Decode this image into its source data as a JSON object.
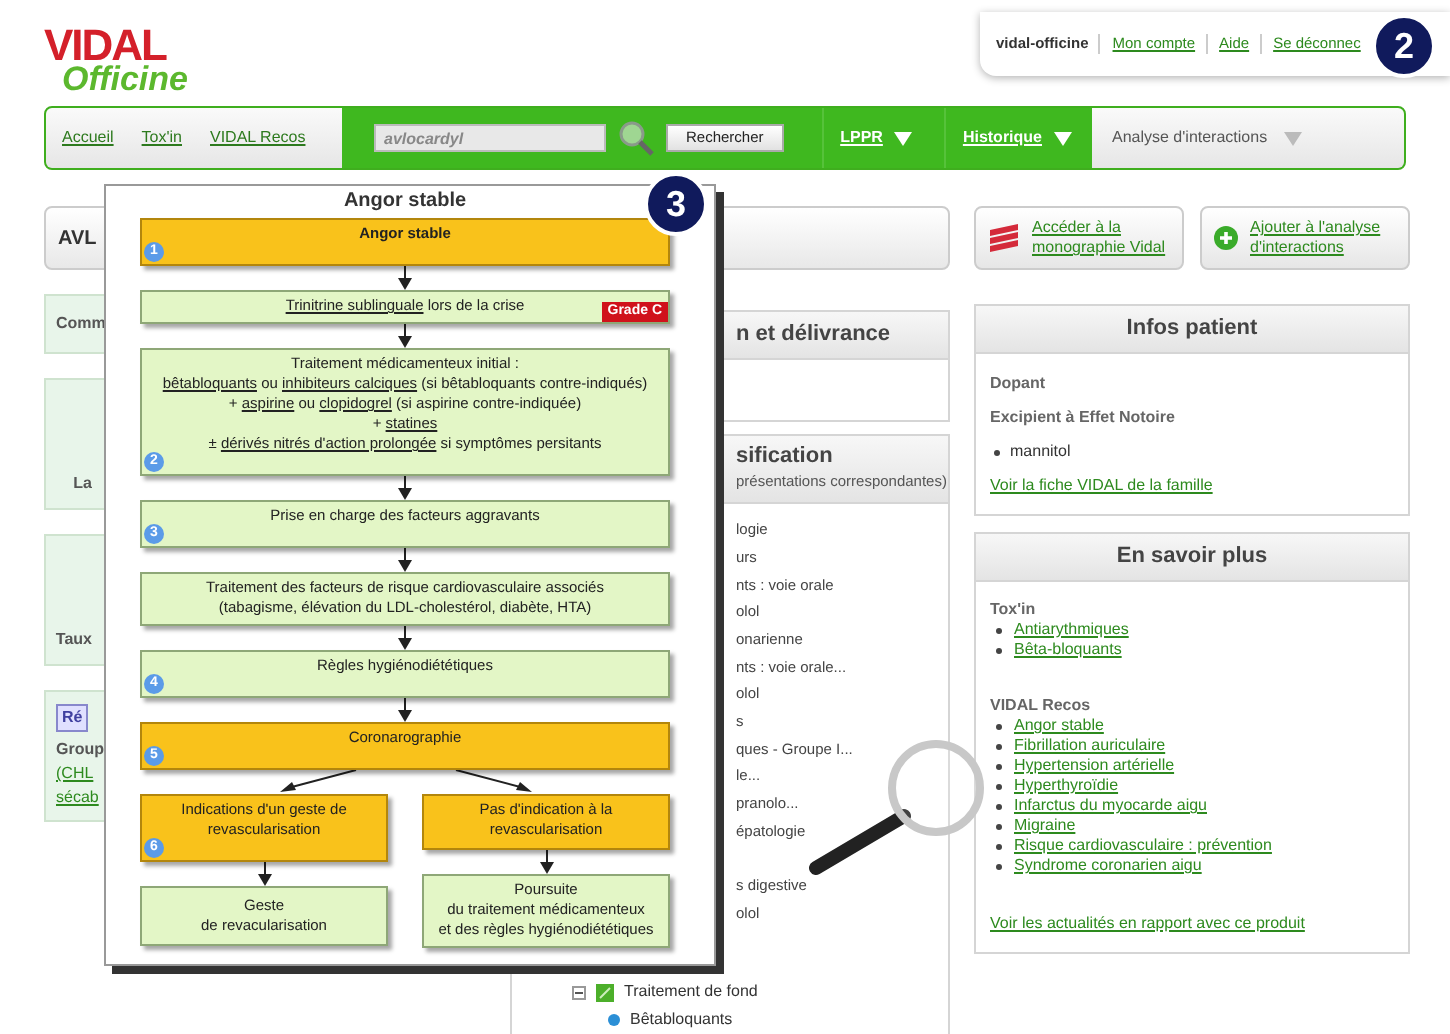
{
  "logo": {
    "line_1": "VIDAL",
    "line_2": "Officine"
  },
  "account_bar": {
    "user": "vidal-officine",
    "links": [
      "Mon compte",
      "Aide",
      "Se déconnec"
    ]
  },
  "callouts": [
    "2",
    "3"
  ],
  "nav": {
    "links": [
      "Accueil",
      "Tox'in",
      "VIDAL Recos"
    ],
    "search": {
      "value": "avlocardyl"
    },
    "search_button": "Rechercher",
    "menus": [
      {
        "label": "LPPR",
        "kind": "green"
      },
      {
        "label": "Historique",
        "kind": "green"
      },
      {
        "label": "Analyse d'interactions",
        "kind": "plain"
      }
    ]
  },
  "left_column": {
    "title": "AVL",
    "boxes": [
      {
        "lines": [
          "Comm"
        ],
        "kind": "center"
      },
      {
        "lines": [
          "La"
        ],
        "kind": "bottom"
      },
      {
        "lines": [
          "Taux"
        ],
        "kind": "bottom"
      },
      {
        "kind": "reimbursement",
        "badge": "Ré",
        "lines": [
          "Group"
        ],
        "links": [
          "(CHL",
          "sécab"
        ]
      }
    ]
  },
  "flowchart": {
    "title": "Angor stable",
    "steps": [
      {
        "kind": "start",
        "badge": "1",
        "lines": [
          [
            {
              "text": "Angor stable",
              "link": false
            }
          ]
        ]
      },
      {
        "kind": "action",
        "grade": "Grade C",
        "lines": [
          [
            {
              "text": "Trinitrine sublinguale",
              "link": true
            },
            {
              "text": " lors de la crise",
              "link": false
            }
          ]
        ]
      },
      {
        "kind": "action",
        "badge": "2",
        "lines": [
          [
            {
              "text": "Traitement médicamenteux initial :",
              "link": false
            }
          ],
          [
            {
              "text": "bêtabloquants",
              "link": true
            },
            {
              "text": " ou ",
              "link": false
            },
            {
              "text": "inhibiteurs calciques",
              "link": true
            },
            {
              "text": " (si bêtabloquants contre-indiqués)",
              "link": false
            }
          ],
          [
            {
              "text": "+ ",
              "link": false
            },
            {
              "text": "aspirine",
              "link": true
            },
            {
              "text": " ou ",
              "link": false
            },
            {
              "text": "clopidogrel",
              "link": true
            },
            {
              "text": " (si aspirine contre-indiquée)",
              "link": false
            }
          ],
          [
            {
              "text": "+ ",
              "link": false
            },
            {
              "text": "statines",
              "link": true
            }
          ],
          [
            {
              "text": "± ",
              "link": false
            },
            {
              "text": "dérivés nitrés d'action prolongée",
              "link": true
            },
            {
              "text": " si symptômes persitants",
              "link": false
            }
          ]
        ]
      },
      {
        "kind": "action",
        "badge": "3",
        "lines": [
          [
            {
              "text": "Prise en charge des facteurs aggravants",
              "link": false
            }
          ]
        ]
      },
      {
        "kind": "action",
        "lines": [
          [
            {
              "text": "Traitement des facteurs de risque cardiovasculaire associés",
              "link": false
            }
          ],
          [
            {
              "text": "(tabagisme, élévation du LDL-cholestérol, diabète, HTA)",
              "link": false
            }
          ]
        ]
      },
      {
        "kind": "action",
        "badge": "4",
        "lines": [
          [
            {
              "text": "Règles hygiénodiététiques",
              "link": false
            }
          ]
        ]
      },
      {
        "kind": "key",
        "badge": "5",
        "lines": [
          [
            {
              "text": "Coronarographie",
              "link": false
            }
          ]
        ]
      }
    ],
    "branches": [
      {
        "decision": {
          "kind": "key",
          "badge": "6",
          "lines": [
            [
              {
                "text": "Indications d'un geste de",
                "link": false
              }
            ],
            [
              {
                "text": "revascularisation",
                "link": false
              }
            ]
          ]
        },
        "outcome": {
          "kind": "action",
          "lines": [
            [
              {
                "text": "Geste",
                "link": false
              }
            ],
            [
              {
                "text": "de revacularisation",
                "link": false
              }
            ]
          ]
        }
      },
      {
        "decision": {
          "kind": "key",
          "lines": [
            [
              {
                "text": "Pas d'indication à la",
                "link": false
              }
            ],
            [
              {
                "text": "revascularisation",
                "link": false
              }
            ]
          ]
        },
        "outcome": {
          "kind": "action",
          "lines": [
            [
              {
                "text": "Poursuite",
                "link": false
              }
            ],
            [
              {
                "text": "du traitement médicamenteux",
                "link": false
              }
            ],
            [
              {
                "text": "et des règles hygiénodiététiques",
                "link": false
              }
            ]
          ]
        }
      }
    ]
  },
  "middle_column": {
    "panels": [
      {
        "title": "n et délivrance"
      },
      {
        "title": "sification",
        "subtitle": "présentations correspondantes)"
      }
    ],
    "tree_fragments": [
      "logie",
      "urs",
      "nts : voie orale",
      "olol",
      "onarienne",
      "nts : voie orale...",
      "olol",
      "s",
      "ques - Groupe I...",
      "le...",
      "pranolo...",
      "épatologie",
      "s digestive",
      "olol"
    ],
    "tree": [
      {
        "label": "Traitement de fond",
        "expanded": true,
        "children": [
          {
            "label": "Bêtabloquants"
          }
        ]
      }
    ]
  },
  "right_column": {
    "actions": [
      {
        "label": "Accéder à la monographie Vidal",
        "kind": "monograph"
      },
      {
        "label": "Ajouter à l'analyse d'interactions",
        "kind": "add"
      }
    ],
    "infos_patient": {
      "title": "Infos patient",
      "headings": [
        "Dopant",
        "Excipient à Effet Notoire"
      ],
      "items": [
        "mannitol"
      ],
      "link": "Voir la fiche VIDAL de la famille"
    },
    "en_savoir_plus": {
      "title": "En savoir plus",
      "sections": [
        {
          "heading": "Tox'in",
          "links": [
            "Antiarythmiques",
            "Bêta-bloquants"
          ]
        },
        {
          "heading": "VIDAL Recos",
          "links": [
            "Angor stable",
            "Fibrillation auriculaire",
            "Hypertension artérielle",
            "Hyperthyroïdie",
            "Infarctus du myocarde aigu",
            "Migraine",
            "Risque cardiovasculaire : prévention",
            "Syndrome coronarien aigu"
          ]
        }
      ],
      "footer_link": "Voir les actualités en rapport avec ce produit"
    }
  }
}
